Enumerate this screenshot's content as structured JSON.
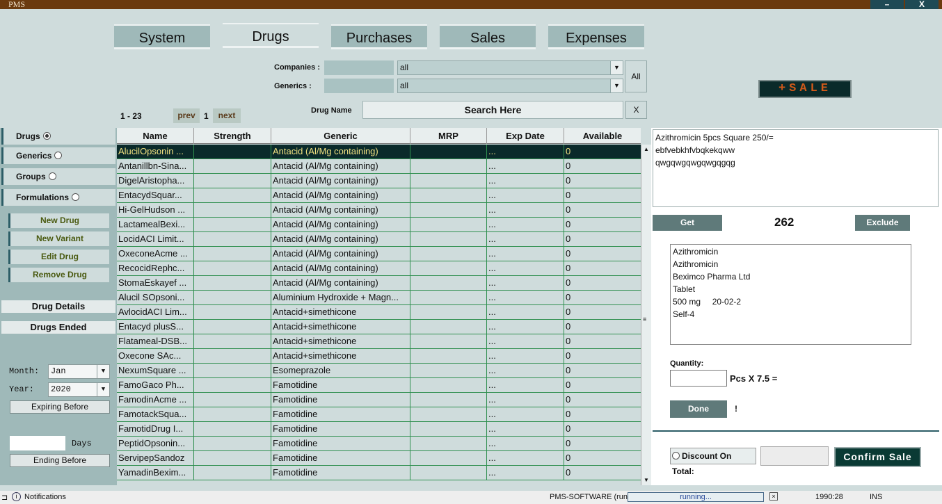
{
  "window": {
    "title": "PMS",
    "minimize": "–",
    "close": "X"
  },
  "tabs": [
    "System",
    "Drugs",
    "Purchases",
    "Sales",
    "Expenses"
  ],
  "filters": {
    "companies_label": "Companies :",
    "companies_value": "all",
    "generics_label": "Generics :",
    "generics_value": "all",
    "all_button": "All"
  },
  "sale_button": "+SALE",
  "pagination": {
    "range": "1 - 23",
    "prev": "prev",
    "page": "1",
    "next": "next"
  },
  "search": {
    "label": "Drug Name",
    "placeholder": "Search Here",
    "clear": "X"
  },
  "left_nav": {
    "items": [
      {
        "label": "Drugs",
        "selected": true
      },
      {
        "label": "Generics",
        "selected": false
      },
      {
        "label": "Groups",
        "selected": false
      },
      {
        "label": "Formulations",
        "selected": false
      }
    ],
    "actions": [
      "New Drug",
      "New Variant",
      "Edit Drug",
      "Remove Drug"
    ],
    "drug_details": "Drug Details",
    "drugs_ended": "Drugs Ended",
    "month_label": "Month:",
    "month_value": "Jan",
    "year_label": "Year:",
    "year_value": "2020",
    "expiring_before": "Expiring Before",
    "days_label": "Days",
    "ending_before": "Ending Before"
  },
  "table": {
    "columns": [
      "Name",
      "Strength",
      "Generic",
      "MRP",
      "Exp Date",
      "Available"
    ],
    "rows": [
      [
        "AlucilOpsonin ...",
        "",
        "Antacid (Al/Mg containing)",
        "",
        "...",
        "0"
      ],
      [
        "Antanillbn-Sina...",
        "",
        "Antacid (Al/Mg containing)",
        "",
        "...",
        "0"
      ],
      [
        "DigelAristopha...",
        "",
        "Antacid (Al/Mg containing)",
        "",
        "...",
        "0"
      ],
      [
        "EntacydSquar...",
        "",
        "Antacid (Al/Mg containing)",
        "",
        "...",
        "0"
      ],
      [
        "Hi-GelHudson ...",
        "",
        "Antacid (Al/Mg containing)",
        "",
        "...",
        "0"
      ],
      [
        "LactamealBexi...",
        "",
        "Antacid (Al/Mg containing)",
        "",
        "...",
        "0"
      ],
      [
        "LocidACI Limit...",
        "",
        "Antacid (Al/Mg containing)",
        "",
        "...",
        "0"
      ],
      [
        "OxeconeAcme ...",
        "",
        "Antacid (Al/Mg containing)",
        "",
        "...",
        "0"
      ],
      [
        "RecocidRephc...",
        "",
        "Antacid (Al/Mg containing)",
        "",
        "...",
        "0"
      ],
      [
        "StomaEskayef ...",
        "",
        "Antacid (Al/Mg containing)",
        "",
        "...",
        "0"
      ],
      [
        "Alucil SOpsoni...",
        "",
        "Aluminium Hydroxide + Magn...",
        "",
        "...",
        "0"
      ],
      [
        "AvlocidACI Lim...",
        "",
        "Antacid+simethicone",
        "",
        "...",
        "0"
      ],
      [
        "Entacyd plusS...",
        "",
        "Antacid+simethicone",
        "",
        "...",
        "0"
      ],
      [
        "Flatameal-DSB...",
        "",
        "Antacid+simethicone",
        "",
        "...",
        "0"
      ],
      [
        "Oxecone SAc...",
        "",
        "Antacid+simethicone",
        "",
        "...",
        "0"
      ],
      [
        "NexumSquare ...",
        "",
        "Esomeprazole",
        "",
        "...",
        "0"
      ],
      [
        "FamoGaco Ph...",
        "",
        "Famotidine",
        "",
        "...",
        "0"
      ],
      [
        "FamodinAcme ...",
        "",
        "Famotidine",
        "",
        "...",
        "0"
      ],
      [
        "FamotackSqua...",
        "",
        "Famotidine",
        "",
        "...",
        "0"
      ],
      [
        "FamotidDrug I...",
        "",
        "Famotidine",
        "",
        "...",
        "0"
      ],
      [
        "PeptidOpsonin...",
        "",
        "Famotidine",
        "",
        "...",
        "0"
      ],
      [
        "ServipepSandoz",
        "",
        "Famotidine",
        "",
        "...",
        "0"
      ],
      [
        "YamadinBexim...",
        "",
        "Famotidine",
        "",
        "...",
        "0"
      ]
    ]
  },
  "right_panel": {
    "note_lines": [
      "Azithromicin  5pcs Square 250/=",
      "ebfvebkhfvbqkekqww",
      "qwgqwgqwgqwgqgqg"
    ],
    "get_button": "Get",
    "count": "262",
    "exclude_button": "Exclude",
    "info_lines": [
      "Azithromicin",
      "Azithromicin",
      "Beximco Pharma Ltd",
      "Tablet",
      "500 mg     20-02-2",
      "Self-4"
    ],
    "quantity_label": "Quantity:",
    "pcs_text": "Pcs X 7.5 =",
    "done_button": "Done",
    "done_marker": "!",
    "discount_label": "Discount On Total:",
    "confirm_button": "Confirm Sale"
  },
  "status_bar": {
    "notifications": "Notifications",
    "process": "PMS-SOFTWARE (run)",
    "progress_text": "running...",
    "position": "1990:28",
    "mode": "INS"
  }
}
